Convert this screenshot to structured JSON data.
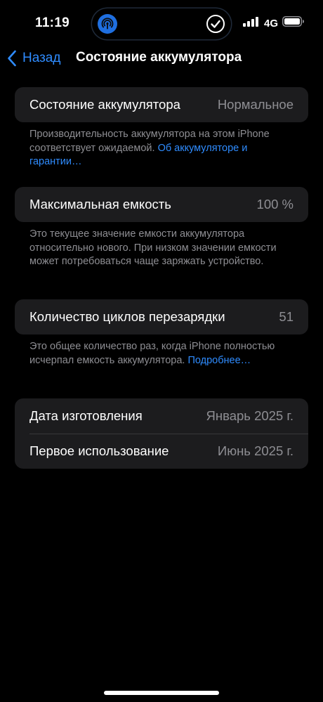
{
  "status_bar": {
    "time": "11:19",
    "network": "4G"
  },
  "nav": {
    "back_label": "Назад",
    "title": "Состояние аккумулятора"
  },
  "sections": {
    "health": {
      "label": "Состояние аккумулятора",
      "value": "Нормальное",
      "footnote_text": "Производительность аккумулятора на этом iPhone соответствует ожидаемой. ",
      "footnote_link": "Об аккумуля­торе и гарантии…"
    },
    "capacity": {
      "label": "Максимальная емкость",
      "value": "100 %",
      "footnote_text": "Это текущее значение емкости аккумулятора относительно нового. При низком значении емкости может потребоваться чаще заряжать устройство."
    },
    "cycles": {
      "label": "Количество циклов перезарядки",
      "value": "51",
      "footnote_text": "Это общее количество раз, когда iPhone полностью исчерпал емкость аккумулятора. ",
      "footnote_link": "Подробнее…"
    },
    "dates": {
      "manufacture_label": "Дата изготовления",
      "manufacture_value": "Январь 2025 г.",
      "first_use_label": "Первое использование",
      "first_use_value": "Июнь 2025 г."
    }
  },
  "colors": {
    "accent": "#2f8cff",
    "card_bg": "#1c1c1e",
    "secondary_text": "#8e8e93"
  },
  "icons": {
    "island_left": "airdrop-icon",
    "island_right": "checkmark-circle-icon",
    "signal": "cellular-signal-icon",
    "battery": "battery-icon",
    "back": "chevron-left-icon"
  }
}
